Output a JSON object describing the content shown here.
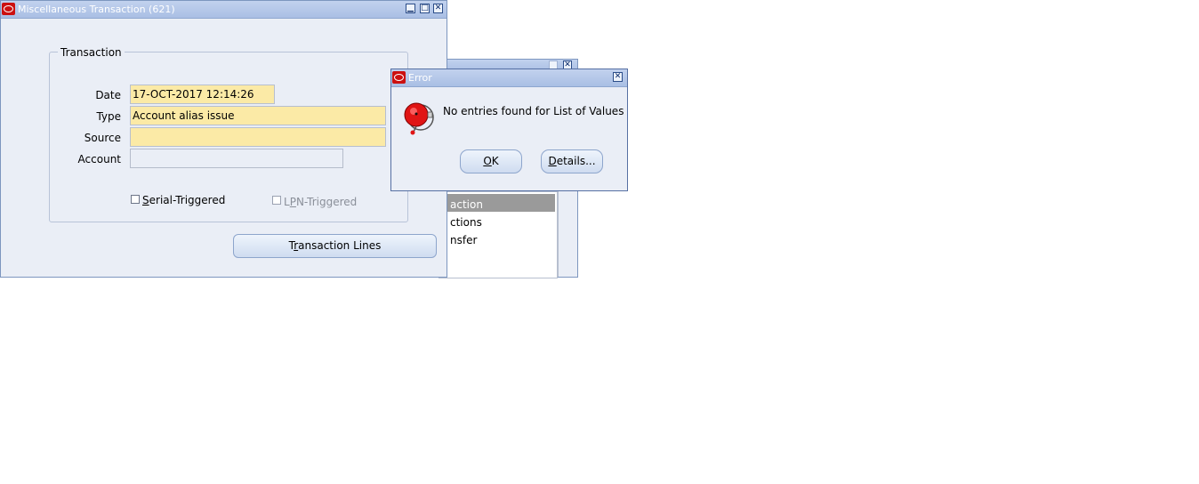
{
  "back_window": {
    "list_items": [
      "action",
      "ctions",
      "nsfer"
    ]
  },
  "main_window": {
    "title": "Miscellaneous Transaction (621)",
    "group_title": "Transaction",
    "fields": {
      "date_label": "Date",
      "date_value": "17-OCT-2017 12:14:26",
      "type_label": "Type",
      "type_value": "Account alias issue",
      "source_label": "Source",
      "source_value": "",
      "account_label": "Account",
      "account_value": ""
    },
    "checkboxes": {
      "serial_prefix": "",
      "serial_mnemonic": "S",
      "serial_rest": "erial-Triggered",
      "lpn_prefix": "L",
      "lpn_mnemonic": "P",
      "lpn_rest": "N-Triggered"
    },
    "transaction_lines_button": {
      "prefix": "T",
      "mnemonic": "r",
      "rest": "ansaction Lines"
    }
  },
  "error_dialog": {
    "title": "Error",
    "message": "No entries found for List of Values",
    "ok_mnemonic": "O",
    "ok_rest": "K",
    "details_mnemonic": "D",
    "details_rest": "etails..."
  },
  "colors": {
    "titlebar": "#a9bfe4",
    "window_bg": "#eaeef6",
    "required_field": "#fbeaa6",
    "oracle_red": "#cc1010",
    "selected_row": "#9a9a9a"
  }
}
